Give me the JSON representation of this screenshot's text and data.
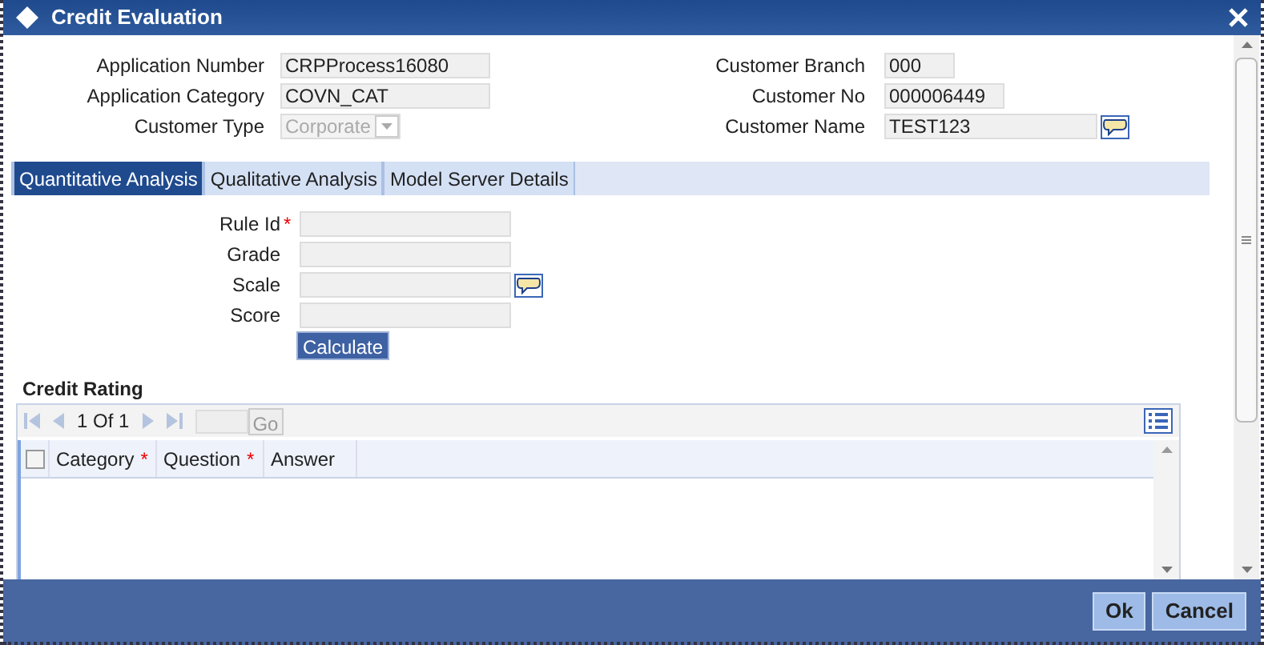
{
  "window": {
    "title": "Credit Evaluation"
  },
  "header_left": [
    {
      "label": "Application Number",
      "value": "CRPProcess16080",
      "kind": "text"
    },
    {
      "label": "Application Category",
      "value": "COVN_CAT",
      "kind": "text"
    },
    {
      "label": "Customer Type",
      "value": "Corporate",
      "kind": "select",
      "disabled": true
    }
  ],
  "header_right": [
    {
      "label": "Customer Branch",
      "value": "000",
      "kind": "short"
    },
    {
      "label": "Customer No",
      "value": "000006449",
      "kind": "medium"
    },
    {
      "label": "Customer Name",
      "value": "TEST123",
      "kind": "lookup"
    }
  ],
  "tabs": [
    {
      "label": "Quantitative Analysis",
      "selected": true
    },
    {
      "label": "Qualitative Analysis",
      "selected": false
    },
    {
      "label": "Model Server Details",
      "selected": false
    }
  ],
  "form_fields": [
    {
      "label": "Rule Id",
      "required": true,
      "kind": "text"
    },
    {
      "label": "Grade",
      "required": false,
      "kind": "text"
    },
    {
      "label": "Scale",
      "required": false,
      "kind": "lookup"
    },
    {
      "label": "Score",
      "required": false,
      "kind": "text"
    }
  ],
  "required_mark": "*",
  "calculate_button": "Calculate",
  "credit_rating": {
    "title": "Credit Rating",
    "pager": {
      "page": "1",
      "of": "Of",
      "total": "1",
      "go": "Go"
    },
    "select_all_checked": false,
    "columns": [
      {
        "label": "Category",
        "required": true
      },
      {
        "label": "Question",
        "required": true
      },
      {
        "label": "Answer",
        "required": false
      }
    ]
  },
  "buttons": [
    "Ok",
    "Cancel"
  ]
}
